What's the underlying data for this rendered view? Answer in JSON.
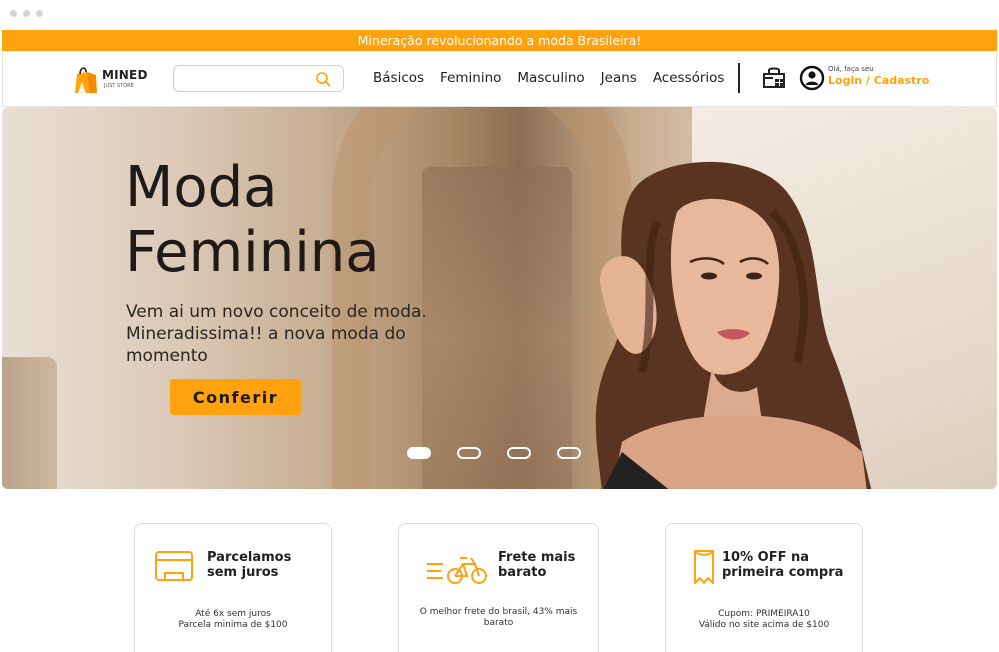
{
  "promo": {
    "text": "Mineração revolucionando a moda Brasileira!"
  },
  "brand": {
    "name": "MINED",
    "tagline": "JUST STORE"
  },
  "search": {
    "value": "",
    "placeholder": ""
  },
  "nav": [
    "Básicos",
    "Feminino",
    "Masculino",
    "Jeans",
    "Acessórios"
  ],
  "user": {
    "greeting": "Olá, faça seu",
    "login_label": "Login / Cadastro"
  },
  "hero": {
    "title_line1": "Moda",
    "title_line2": "Feminina",
    "description": "Vem ai um novo conceito de moda. Mineradissima!! a nova moda do momento",
    "cta_label": "Conferir",
    "slides": 4,
    "active_slide": 1
  },
  "features": [
    {
      "icon": "card-icon",
      "title_line1": "Parcelamos",
      "title_line2": "sem juros",
      "desc_line1": "Até 6x sem juros",
      "desc_line2": "Parcela minima de $100"
    },
    {
      "icon": "bicycle-icon",
      "title_line1": "Frete mais",
      "title_line2": "barato",
      "desc_line1": "O melhor frete do brasil, 43% mais",
      "desc_line2": "barato"
    },
    {
      "icon": "coupon-icon",
      "title_line1": "10% OFF na",
      "title_line2": "primeira compra",
      "desc_line1": "Cupom: PRIMEIRA10",
      "desc_line2": "Válido no site acima de $100"
    }
  ],
  "colors": {
    "accent": "#ffa20d",
    "text": "#222222"
  }
}
